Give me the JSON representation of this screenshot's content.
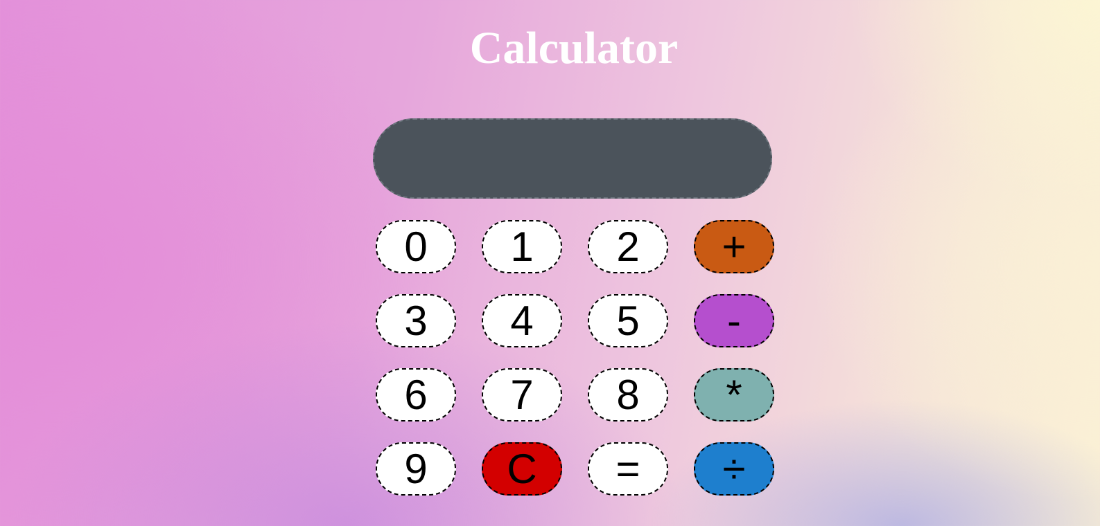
{
  "app": {
    "title": "Calculator"
  },
  "display": {
    "value": ""
  },
  "keys": [
    {
      "label": "0",
      "name": "digit-0-button"
    },
    {
      "label": "1",
      "name": "digit-1-button"
    },
    {
      "label": "2",
      "name": "digit-2-button"
    },
    {
      "label": "+",
      "name": "add-button"
    },
    {
      "label": "3",
      "name": "digit-3-button"
    },
    {
      "label": "4",
      "name": "digit-4-button"
    },
    {
      "label": "5",
      "name": "digit-5-button"
    },
    {
      "label": "-",
      "name": "subtract-button"
    },
    {
      "label": "6",
      "name": "digit-6-button"
    },
    {
      "label": "7",
      "name": "digit-7-button"
    },
    {
      "label": "8",
      "name": "digit-8-button"
    },
    {
      "label": "*",
      "name": "multiply-button"
    },
    {
      "label": "9",
      "name": "digit-9-button"
    },
    {
      "label": "C",
      "name": "clear-button"
    },
    {
      "label": "=",
      "name": "equals-button"
    },
    {
      "label": "÷",
      "name": "divide-button"
    }
  ],
  "colors": {
    "display_background": "#4b535b",
    "add": "#c95a13",
    "subtract": "#b54fce",
    "multiply": "#7fb1af",
    "divide": "#1e7fce",
    "clear": "#d30000",
    "digit": "#ffffff",
    "title": "#ffffff"
  }
}
